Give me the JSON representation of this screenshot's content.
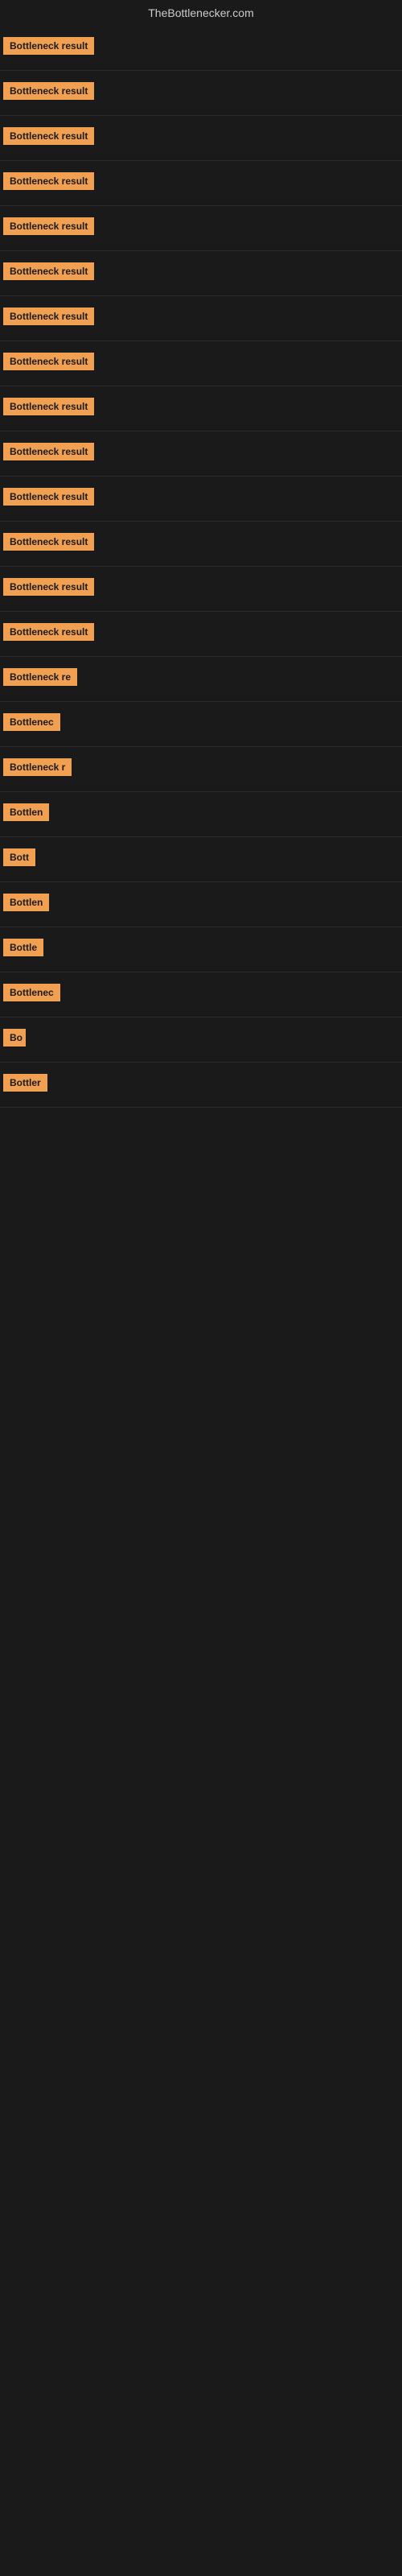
{
  "header": {
    "title": "TheBottlenecker.com"
  },
  "items": [
    {
      "label": "Bottleneck result",
      "width": 120
    },
    {
      "label": "Bottleneck result",
      "width": 120
    },
    {
      "label": "Bottleneck result",
      "width": 120
    },
    {
      "label": "Bottleneck result",
      "width": 120
    },
    {
      "label": "Bottleneck result",
      "width": 120
    },
    {
      "label": "Bottleneck result",
      "width": 120
    },
    {
      "label": "Bottleneck result",
      "width": 120
    },
    {
      "label": "Bottleneck result",
      "width": 120
    },
    {
      "label": "Bottleneck result",
      "width": 120
    },
    {
      "label": "Bottleneck result",
      "width": 120
    },
    {
      "label": "Bottleneck result",
      "width": 120
    },
    {
      "label": "Bottleneck result",
      "width": 120
    },
    {
      "label": "Bottleneck result",
      "width": 120
    },
    {
      "label": "Bottleneck result",
      "width": 120
    },
    {
      "label": "Bottleneck re",
      "width": 100
    },
    {
      "label": "Bottlenec",
      "width": 80
    },
    {
      "label": "Bottleneck r",
      "width": 88
    },
    {
      "label": "Bottlen",
      "width": 68
    },
    {
      "label": "Bott",
      "width": 44
    },
    {
      "label": "Bottlen",
      "width": 68
    },
    {
      "label": "Bottle",
      "width": 56
    },
    {
      "label": "Bottlenec",
      "width": 80
    },
    {
      "label": "Bo",
      "width": 28
    },
    {
      "label": "Bottler",
      "width": 60
    }
  ]
}
